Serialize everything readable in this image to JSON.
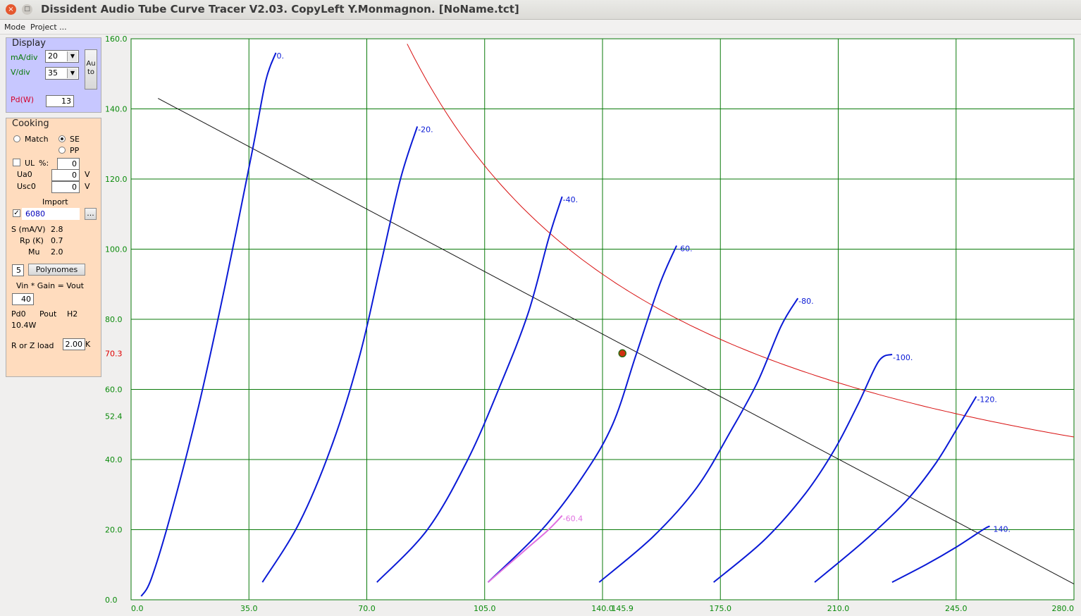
{
  "window": {
    "title": "Dissident Audio Tube Curve Tracer V2.03. CopyLeft Y.Monmagnon. [NoName.tct]",
    "close_glyph": "×",
    "max_glyph": "□"
  },
  "menu": {
    "items": [
      "Mode",
      "Project ..."
    ]
  },
  "display": {
    "legend": "Display",
    "ma_div_label": "mA/div",
    "ma_div_value": "20",
    "v_div_label": "V/div",
    "v_div_value": "35",
    "auto_label": "Auto",
    "pd_label": "Pd(W)",
    "pd_value": "13"
  },
  "cooking": {
    "legend": "Cooking",
    "match_label": "Match",
    "se_label": "SE",
    "pp_label": "PP",
    "ul_label": "UL",
    "ul_percent": "%:",
    "ul_value": "0",
    "ua0_label": "Ua0",
    "ua0_value": "0",
    "ua0_unit": "V",
    "usc0_label": "Usc0",
    "usc0_value": "0",
    "usc0_unit": "V",
    "import_label": "Import",
    "tube_value": "6080",
    "browse_label": "...",
    "s_label": "S (mA/V)",
    "s_value": "2.8",
    "rp_label": "Rp (K)",
    "rp_value": "0.7",
    "mu_label": "Mu",
    "mu_value": "2.0",
    "poly_value": "5",
    "poly_button": "Polynomes",
    "gain_text": "Vin  * Gain = Vout",
    "vin_value": "40",
    "pd0_label": "Pd0",
    "pout_label": "Pout",
    "h2_label": "H2",
    "pd0_value": "10.4W",
    "load_label": "R or Z load",
    "load_value": "2.00",
    "load_unit": "K"
  },
  "chart_data": {
    "type": "line",
    "xlim": [
      0,
      280
    ],
    "ylim": [
      0,
      160
    ],
    "x_ticks": [
      "0.0",
      "35.0",
      "70.0",
      "105.0",
      "140.0",
      "175.0",
      "210.0",
      "245.0",
      "280.0"
    ],
    "x_tick_values": [
      0,
      35,
      70,
      105,
      140,
      175,
      210,
      245,
      280
    ],
    "y_ticks": [
      "0.0",
      "20.0",
      "40.0",
      "60.0",
      "80.0",
      "100.0",
      "120.0",
      "140.0",
      "160.0"
    ],
    "y_tick_values": [
      0,
      20,
      40,
      60,
      80,
      100,
      120,
      140,
      160
    ],
    "extra_x_label": {
      "value": 145.9,
      "text": "145.9"
    },
    "extra_y_labels": [
      {
        "value": 70.3,
        "text": "70.3",
        "color": "#e00000"
      },
      {
        "value": 52.4,
        "text": "52.4",
        "color": "#0a8a0a"
      }
    ],
    "grid": true,
    "pd_watts": 13,
    "load_line": {
      "x": [
        8,
        280
      ],
      "y": [
        143,
        4.5
      ]
    },
    "operating_point": {
      "x": 145.9,
      "y": 70.3
    },
    "series": [
      {
        "label": "0.",
        "x": [
          3,
          6,
          12,
          20,
          28,
          36,
          40,
          43
        ],
        "y": [
          1,
          6,
          25,
          55,
          90,
          128,
          148,
          156
        ]
      },
      {
        "label": "-20.",
        "x": [
          39,
          50,
          60,
          68,
          74,
          80,
          85
        ],
        "y": [
          5,
          22,
          45,
          70,
          95,
          120,
          135
        ]
      },
      {
        "label": "-40.",
        "x": [
          73,
          88,
          100,
          110,
          118,
          124,
          128
        ],
        "y": [
          5,
          20,
          40,
          62,
          82,
          103,
          115
        ]
      },
      {
        "label": "-60.",
        "x": [
          106,
          122,
          134,
          143,
          150,
          157,
          162
        ],
        "y": [
          5,
          20,
          35,
          50,
          70,
          90,
          101
        ]
      },
      {
        "label": "-80.",
        "x": [
          139,
          155,
          168,
          178,
          186,
          193,
          198
        ],
        "y": [
          5,
          18,
          32,
          48,
          62,
          78,
          86
        ]
      },
      {
        "label": "-100.",
        "x": [
          173,
          188,
          200,
          209,
          216,
          222,
          226
        ],
        "y": [
          5,
          17,
          30,
          43,
          56,
          68,
          70
        ]
      },
      {
        "label": "-120.",
        "x": [
          203,
          218,
          230,
          239,
          246,
          251
        ],
        "y": [
          5,
          17,
          28,
          39,
          50,
          58
        ]
      },
      {
        "label": "-140.",
        "x": [
          226,
          236,
          245,
          253,
          255
        ],
        "y": [
          5,
          10,
          15,
          20,
          21
        ]
      }
    ],
    "highlight": {
      "label": "-60.4",
      "x": [
        106,
        112,
        118,
        124,
        128
      ],
      "y": [
        5,
        10,
        15,
        20,
        24
      ]
    }
  }
}
